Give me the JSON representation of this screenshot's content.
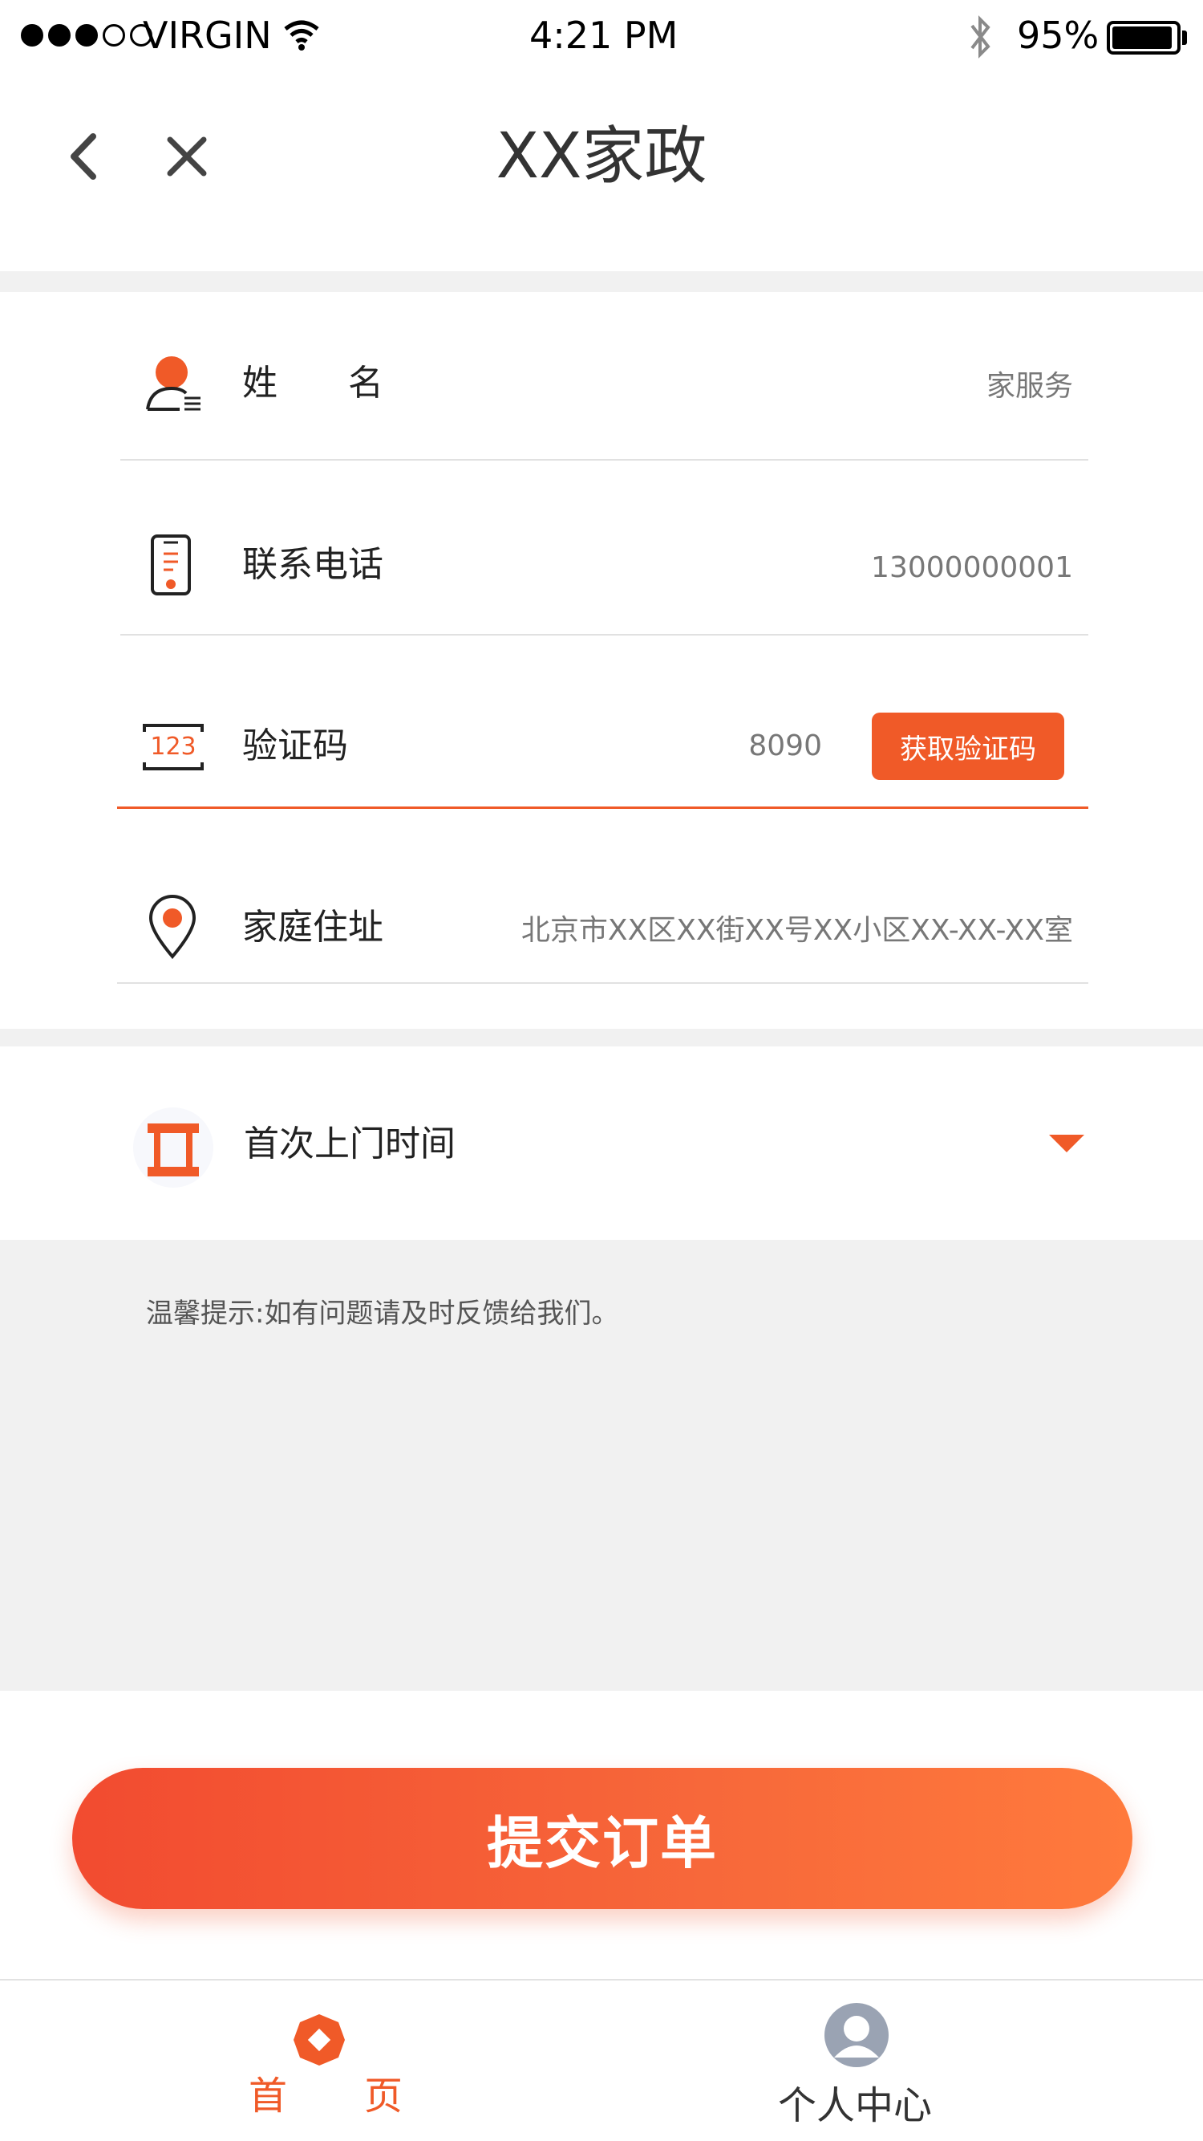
{
  "status_bar": {
    "carrier": "VIRGIN",
    "time": "4:21 PM",
    "battery": "95%",
    "battery_level": 0.95,
    "signal_bars": 3,
    "icons": [
      "wifi-icon",
      "bluetooth-icon",
      "battery-icon"
    ]
  },
  "nav": {
    "title": "XX家政",
    "icons": [
      "back-arrow-icon",
      "close-icon"
    ]
  },
  "form": {
    "name": {
      "label": "姓　　名",
      "value": "家服务",
      "icon": "user-icon"
    },
    "phone": {
      "label": "联系电话",
      "value": "13000000001",
      "icon": "phone-icon"
    },
    "code": {
      "label": "验证码",
      "value": "8090",
      "icon_text": "123",
      "button": "获取验证码"
    },
    "address": {
      "label": "家庭住址",
      "value": "北京市XX区XX街XX号XX小区XX-XX-XX室",
      "icon": "location-pin-icon"
    },
    "visit_time": {
      "label": "首次上门时间",
      "icon": "calendar-icon",
      "dropdown_icon": "caret-down-icon"
    }
  },
  "tips": {
    "text": "温馨提示:如有问题请及时反馈给我们。"
  },
  "submit": {
    "label": "提交订单"
  },
  "tabbar": {
    "home": {
      "label": "首　　页",
      "icon": "home-icon",
      "active": true
    },
    "profile": {
      "label": "个人中心",
      "icon": "profile-icon",
      "active": false
    }
  },
  "colors": {
    "accent": "#f05a28",
    "active_tab": "#f05a28",
    "inactive_tab": "#333333",
    "background_gray": "#f1f1f1"
  }
}
